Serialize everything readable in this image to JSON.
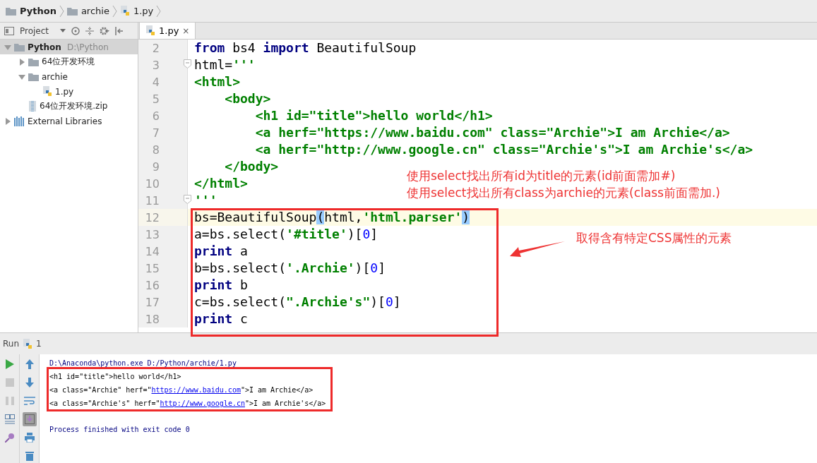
{
  "breadcrumbs": [
    {
      "kind": "folder",
      "label": "Python"
    },
    {
      "kind": "folder",
      "label": "archie"
    },
    {
      "kind": "pyfile",
      "label": "1.py"
    }
  ],
  "project_panel": {
    "title": "Project",
    "tree": [
      {
        "kind": "folder",
        "label": "Python",
        "path": "D:\\Python",
        "expanded": true,
        "selected": true,
        "children": [
          {
            "kind": "folder",
            "label": "64位开发环境",
            "expanded": false,
            "selected": false
          },
          {
            "kind": "folder",
            "label": "archie",
            "expanded": true,
            "selected": false,
            "children": [
              {
                "kind": "pyfile",
                "label": "1.py",
                "selected": false
              }
            ]
          },
          {
            "kind": "zip",
            "label": "64位开发环境.zip",
            "selected": false
          }
        ]
      },
      {
        "kind": "library",
        "label": "External Libraries",
        "expanded": false,
        "selected": false
      }
    ]
  },
  "editor": {
    "tabs": [
      {
        "label": "1.py",
        "close": "×",
        "selected": true
      }
    ],
    "lines": [
      {
        "number": "2",
        "current": false,
        "tokens": [
          {
            "kind": "kw",
            "text": "from"
          },
          {
            "kind": "plain",
            "text": " bs4 "
          },
          {
            "kind": "kw",
            "text": "import"
          },
          {
            "kind": "plain",
            "text": " BeautifulSoup"
          }
        ]
      },
      {
        "number": "3",
        "current": false,
        "fold": true,
        "tokens": [
          {
            "kind": "plain",
            "text": "html="
          },
          {
            "kind": "str",
            "text": "'''"
          }
        ]
      },
      {
        "number": "4",
        "current": false,
        "tokens": [
          {
            "kind": "str",
            "text": "<html>"
          }
        ]
      },
      {
        "number": "5",
        "current": false,
        "tokens": [
          {
            "kind": "str",
            "text": "    <body>"
          }
        ]
      },
      {
        "number": "6",
        "current": false,
        "tokens": [
          {
            "kind": "str",
            "text": "        <h1 id=\"title\">hello world</h1>"
          }
        ]
      },
      {
        "number": "7",
        "current": false,
        "tokens": [
          {
            "kind": "str",
            "text": "        <a herf=\"https://www.baidu.com\" class=\"Archie\">I am Archie</a>"
          }
        ]
      },
      {
        "number": "8",
        "current": false,
        "tokens": [
          {
            "kind": "str",
            "text": "        <a herf=\"http://www.google.cn\" class=\"Archie's\">I am Archie's</a>"
          }
        ]
      },
      {
        "number": "9",
        "current": false,
        "tokens": [
          {
            "kind": "str",
            "text": "    </body>"
          }
        ]
      },
      {
        "number": "10",
        "current": false,
        "tokens": [
          {
            "kind": "str",
            "text": "</html>"
          }
        ]
      },
      {
        "number": "11",
        "current": false,
        "fold": true,
        "tokens": [
          {
            "kind": "str",
            "text": "'''"
          }
        ]
      },
      {
        "number": "12",
        "current": true,
        "tokens": [
          {
            "kind": "plain",
            "text": "bs=BeautifulSoup"
          },
          {
            "kind": "match",
            "text": "("
          },
          {
            "kind": "plain",
            "text": "html,"
          },
          {
            "kind": "str",
            "text": "'html.parser'"
          },
          {
            "kind": "match",
            "text": ")"
          }
        ]
      },
      {
        "number": "13",
        "current": false,
        "tokens": [
          {
            "kind": "plain",
            "text": "a=bs.select("
          },
          {
            "kind": "str",
            "text": "'#title'"
          },
          {
            "kind": "plain",
            "text": ")["
          },
          {
            "kind": "num",
            "text": "0"
          },
          {
            "kind": "plain",
            "text": "]"
          }
        ]
      },
      {
        "number": "14",
        "current": false,
        "tokens": [
          {
            "kind": "kw",
            "text": "print"
          },
          {
            "kind": "plain",
            "text": " a"
          }
        ]
      },
      {
        "number": "15",
        "current": false,
        "tokens": [
          {
            "kind": "plain",
            "text": "b=bs.select("
          },
          {
            "kind": "str",
            "text": "'.Archie'"
          },
          {
            "kind": "plain",
            "text": ")["
          },
          {
            "kind": "num",
            "text": "0"
          },
          {
            "kind": "plain",
            "text": "]"
          }
        ]
      },
      {
        "number": "16",
        "current": false,
        "tokens": [
          {
            "kind": "kw",
            "text": "print"
          },
          {
            "kind": "plain",
            "text": " b"
          }
        ]
      },
      {
        "number": "17",
        "current": false,
        "tokens": [
          {
            "kind": "plain",
            "text": "c=bs.select("
          },
          {
            "kind": "str",
            "text": "\".Archie's\""
          },
          {
            "kind": "plain",
            "text": ")["
          },
          {
            "kind": "num",
            "text": "0"
          },
          {
            "kind": "plain",
            "text": "]"
          }
        ]
      },
      {
        "number": "18",
        "current": false,
        "tokens": [
          {
            "kind": "kw",
            "text": "print"
          },
          {
            "kind": "plain",
            "text": " c"
          }
        ]
      }
    ]
  },
  "annotations": {
    "notes": [
      "使用select找出所有id为title的元素(id前面需加#)",
      "使用select找出所有class为archie的元素(class前面需加.)"
    ],
    "callout": "取得含有特定CSS属性的元素"
  },
  "run_panel": {
    "title": "Run",
    "config": "1",
    "console": [
      {
        "kind": "command",
        "parts": [
          {
            "text": "D:\\Anaconda\\python.exe D:/Python/archie/1.py",
            "link": false
          }
        ]
      },
      {
        "kind": "output",
        "parts": [
          {
            "text": "<h1 id=\"title\">hello world</h1>",
            "link": false
          }
        ]
      },
      {
        "kind": "output",
        "parts": [
          {
            "text": "<a class=\"Archie\" herf=\"",
            "link": false
          },
          {
            "text": "https://www.baidu.com",
            "link": true
          },
          {
            "text": "\">I am Archie</a>",
            "link": false
          }
        ]
      },
      {
        "kind": "output",
        "parts": [
          {
            "text": "<a class=\"Archie's\" herf=\"",
            "link": false
          },
          {
            "text": "http://www.google.cn",
            "link": true
          },
          {
            "text": "\">I am Archie's</a>",
            "link": false
          }
        ]
      },
      {
        "kind": "status",
        "parts": [
          {
            "text": "Process finished with exit code 0",
            "link": false
          }
        ]
      }
    ]
  }
}
